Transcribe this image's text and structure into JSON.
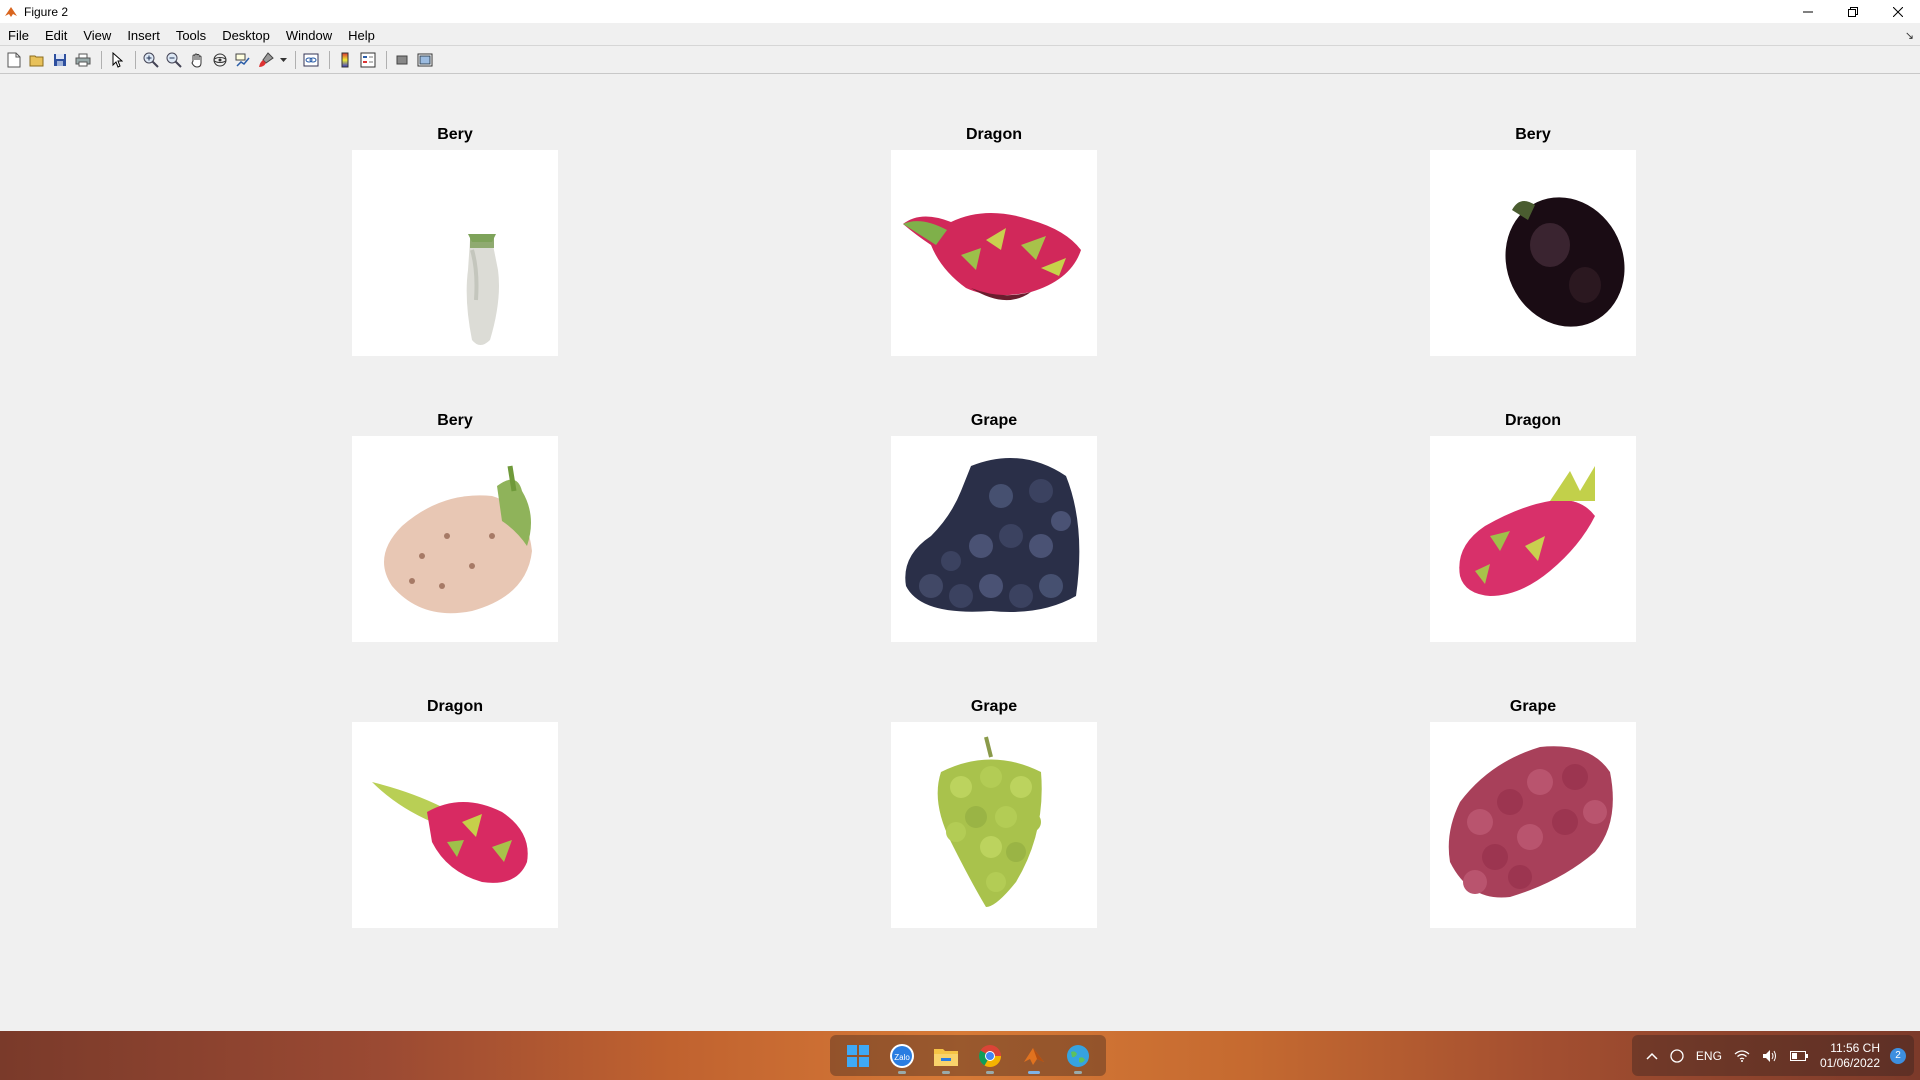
{
  "window": {
    "title": "Figure 2",
    "controls": [
      "minimize",
      "restore",
      "close"
    ]
  },
  "menubar": {
    "items": [
      {
        "label": "File"
      },
      {
        "label": "Edit"
      },
      {
        "label": "View"
      },
      {
        "label": "Insert"
      },
      {
        "label": "Tools"
      },
      {
        "label": "Desktop"
      },
      {
        "label": "Window"
      },
      {
        "label": "Help"
      }
    ]
  },
  "toolbar": {
    "icons": [
      "new-figure-icon",
      "open-file-icon",
      "save-icon",
      "print-icon",
      "edit-plot-icon",
      "zoom-in-icon",
      "zoom-out-icon",
      "pan-icon",
      "rotate-3d-icon",
      "data-cursor-icon",
      "brush-icon",
      "link-plot-icon",
      "insert-colorbar-icon",
      "insert-legend-icon",
      "hide-plot-tools-icon",
      "show-plot-tools-icon"
    ]
  },
  "figure": {
    "subplots": [
      {
        "title": "Bery",
        "fruit": "white strawberry"
      },
      {
        "title": "Dragon",
        "fruit": "dragon fruit"
      },
      {
        "title": "Bery",
        "fruit": "blackberry"
      },
      {
        "title": "Bery",
        "fruit": "pineberry"
      },
      {
        "title": "Grape",
        "fruit": "black grapes"
      },
      {
        "title": "Dragon",
        "fruit": "dragon fruit"
      },
      {
        "title": "Dragon",
        "fruit": "dragon fruit"
      },
      {
        "title": "Grape",
        "fruit": "green grapes"
      },
      {
        "title": "Grape",
        "fruit": "red grapes"
      }
    ]
  },
  "taskbar": {
    "apps": [
      "windows-start-icon",
      "zalo-icon",
      "file-explorer-icon",
      "chrome-icon",
      "matlab-icon",
      "network-globe-icon"
    ],
    "tray": {
      "language": "ENG",
      "time": "11:56 CH",
      "date": "01/06/2022",
      "notifications": "2"
    }
  }
}
